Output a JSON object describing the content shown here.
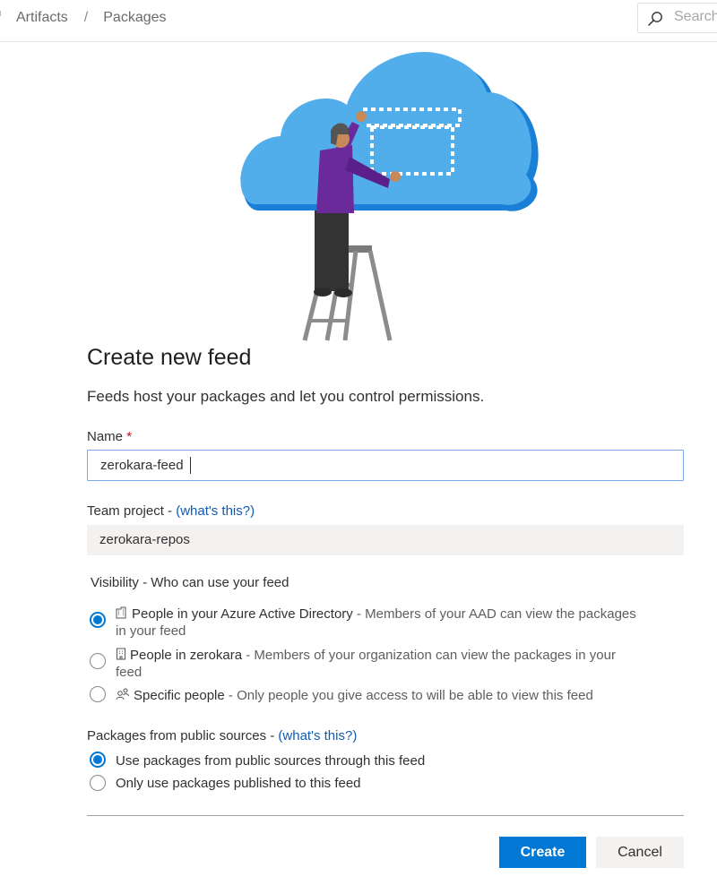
{
  "header": {
    "breadcrumb": [
      "Artifacts",
      "Packages"
    ],
    "breadcrumb_separator": "/",
    "search_placeholder": "Search"
  },
  "illustration": {
    "description": "person on ladder drawing dotted boxes on cloud",
    "icon": "cloud-illustration",
    "colors": {
      "cloud": "#52aeea",
      "cloud_shadow": "#1a7fd6",
      "shirt": "#6b2a9a",
      "pants": "#333333",
      "ladder": "#8c8c8c"
    }
  },
  "form": {
    "title": "Create new feed",
    "subtitle": "Feeds host your packages and let you control permissions.",
    "name": {
      "label": "Name",
      "required_marker": "*",
      "value": "zerokara-feed"
    },
    "team_project": {
      "label": "Team project - ",
      "help_link": "(what's this?)",
      "value": "zerokara-repos"
    },
    "visibility": {
      "label": "Visibility - Who can use your feed",
      "options": [
        {
          "icon": "azure-ad-building-icon",
          "title": "People in your Azure Active Directory",
          "description": " - Members of your AAD can view the packages",
          "description_cont": "in your feed",
          "selected": true
        },
        {
          "icon": "organization-building-icon",
          "title": "People in zerokara",
          "description": " - Members of your organization can view the packages in your",
          "description_cont": "feed",
          "selected": false
        },
        {
          "icon": "people-icon",
          "title": "Specific people",
          "description": " - Only people you give access to will be able to view this feed",
          "selected": false
        }
      ]
    },
    "public_sources": {
      "label": "Packages from public sources - ",
      "help_link": "(what's this?)",
      "options": [
        {
          "label": "Use packages from public sources through this feed",
          "selected": true
        },
        {
          "label": "Only use packages published to this feed",
          "selected": false
        }
      ]
    },
    "buttons": {
      "create": "Create",
      "cancel": "Cancel"
    },
    "colors": {
      "primary": "#0078d4",
      "link": "#0f5ab4",
      "required": "#c50f1f"
    }
  }
}
